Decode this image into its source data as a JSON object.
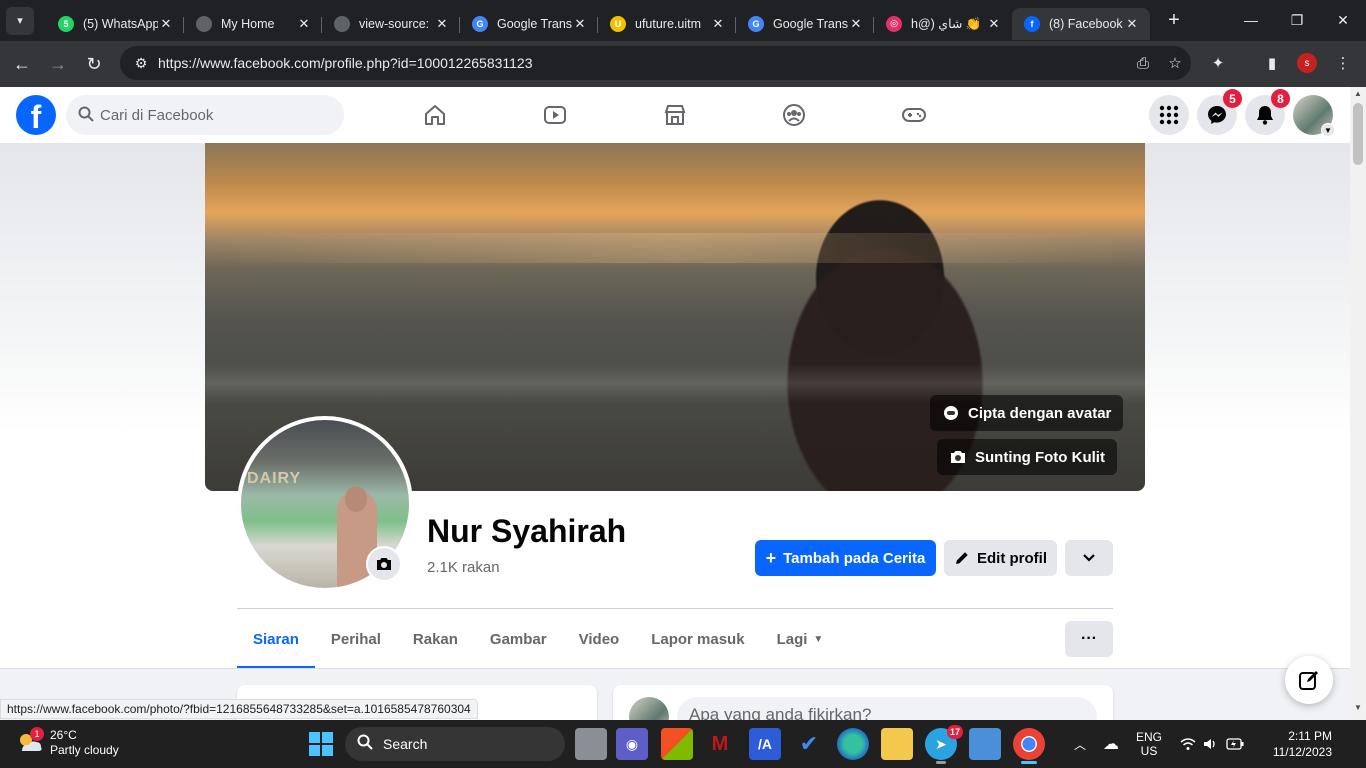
{
  "browser": {
    "tabs": [
      {
        "title": "(5) WhatsApp",
        "icon": "whatsapp-icon",
        "icon_color": "#25d366",
        "icon_glyph": "5"
      },
      {
        "title": "My Home",
        "icon": "globe-icon",
        "icon_color": "#5f6368",
        "icon_glyph": ""
      },
      {
        "title": "view-source:",
        "icon": "globe-icon",
        "icon_color": "#5f6368",
        "icon_glyph": ""
      },
      {
        "title": "Google Trans",
        "icon": "google-translate-icon",
        "icon_color": "#4285f4",
        "icon_glyph": "G"
      },
      {
        "title": "ufuture.uitm",
        "icon": "ufuture-icon",
        "icon_color": "#f2c200",
        "icon_glyph": "U"
      },
      {
        "title": "Google Trans",
        "icon": "google-translate-icon",
        "icon_color": "#4285f4",
        "icon_glyph": "G"
      },
      {
        "title": "h@) شاي 👏",
        "icon": "instagram-icon",
        "icon_color": "#e1306c",
        "icon_glyph": "◎"
      },
      {
        "title": "(8) Facebook",
        "icon": "facebook-icon",
        "icon_color": "#0866ff",
        "icon_glyph": "f",
        "active": true
      }
    ],
    "url": "https://www.facebook.com/profile.php?id=100012265831123",
    "profile_initial": "s",
    "status_url": "https://www.facebook.com/photo/?fbid=1216855648733285&set=a.1016585478760304"
  },
  "facebook": {
    "search_placeholder": "Cari di Facebook",
    "messenger_count": "5",
    "notification_count": "8",
    "brand_color": "#0866ff"
  },
  "profile": {
    "name": "Nur Syahirah",
    "friends": "2.1K rakan",
    "avatar_sign": "DAIRY",
    "cover_buttons": {
      "avatar": "Cipta dengan avatar",
      "edit_cover": "Sunting Foto Kulit"
    },
    "actions": {
      "add_story": "Tambah pada Cerita",
      "edit_profile": "Edit profil"
    },
    "tabs": [
      "Siaran",
      "Perihal",
      "Rakan",
      "Gambar",
      "Video",
      "Lapor masuk",
      "Lagi"
    ],
    "active_tab": "Siaran",
    "composer_placeholder": "Apa yang anda fikirkan?"
  },
  "taskbar": {
    "weather_temp": "26°C",
    "weather_desc": "Partly cloudy",
    "weather_badge": "1",
    "search_label": "Search",
    "telegram_badge": "17",
    "lang_line1": "ENG",
    "lang_line2": "US",
    "time": "2:11 PM",
    "date": "11/12/2023"
  }
}
